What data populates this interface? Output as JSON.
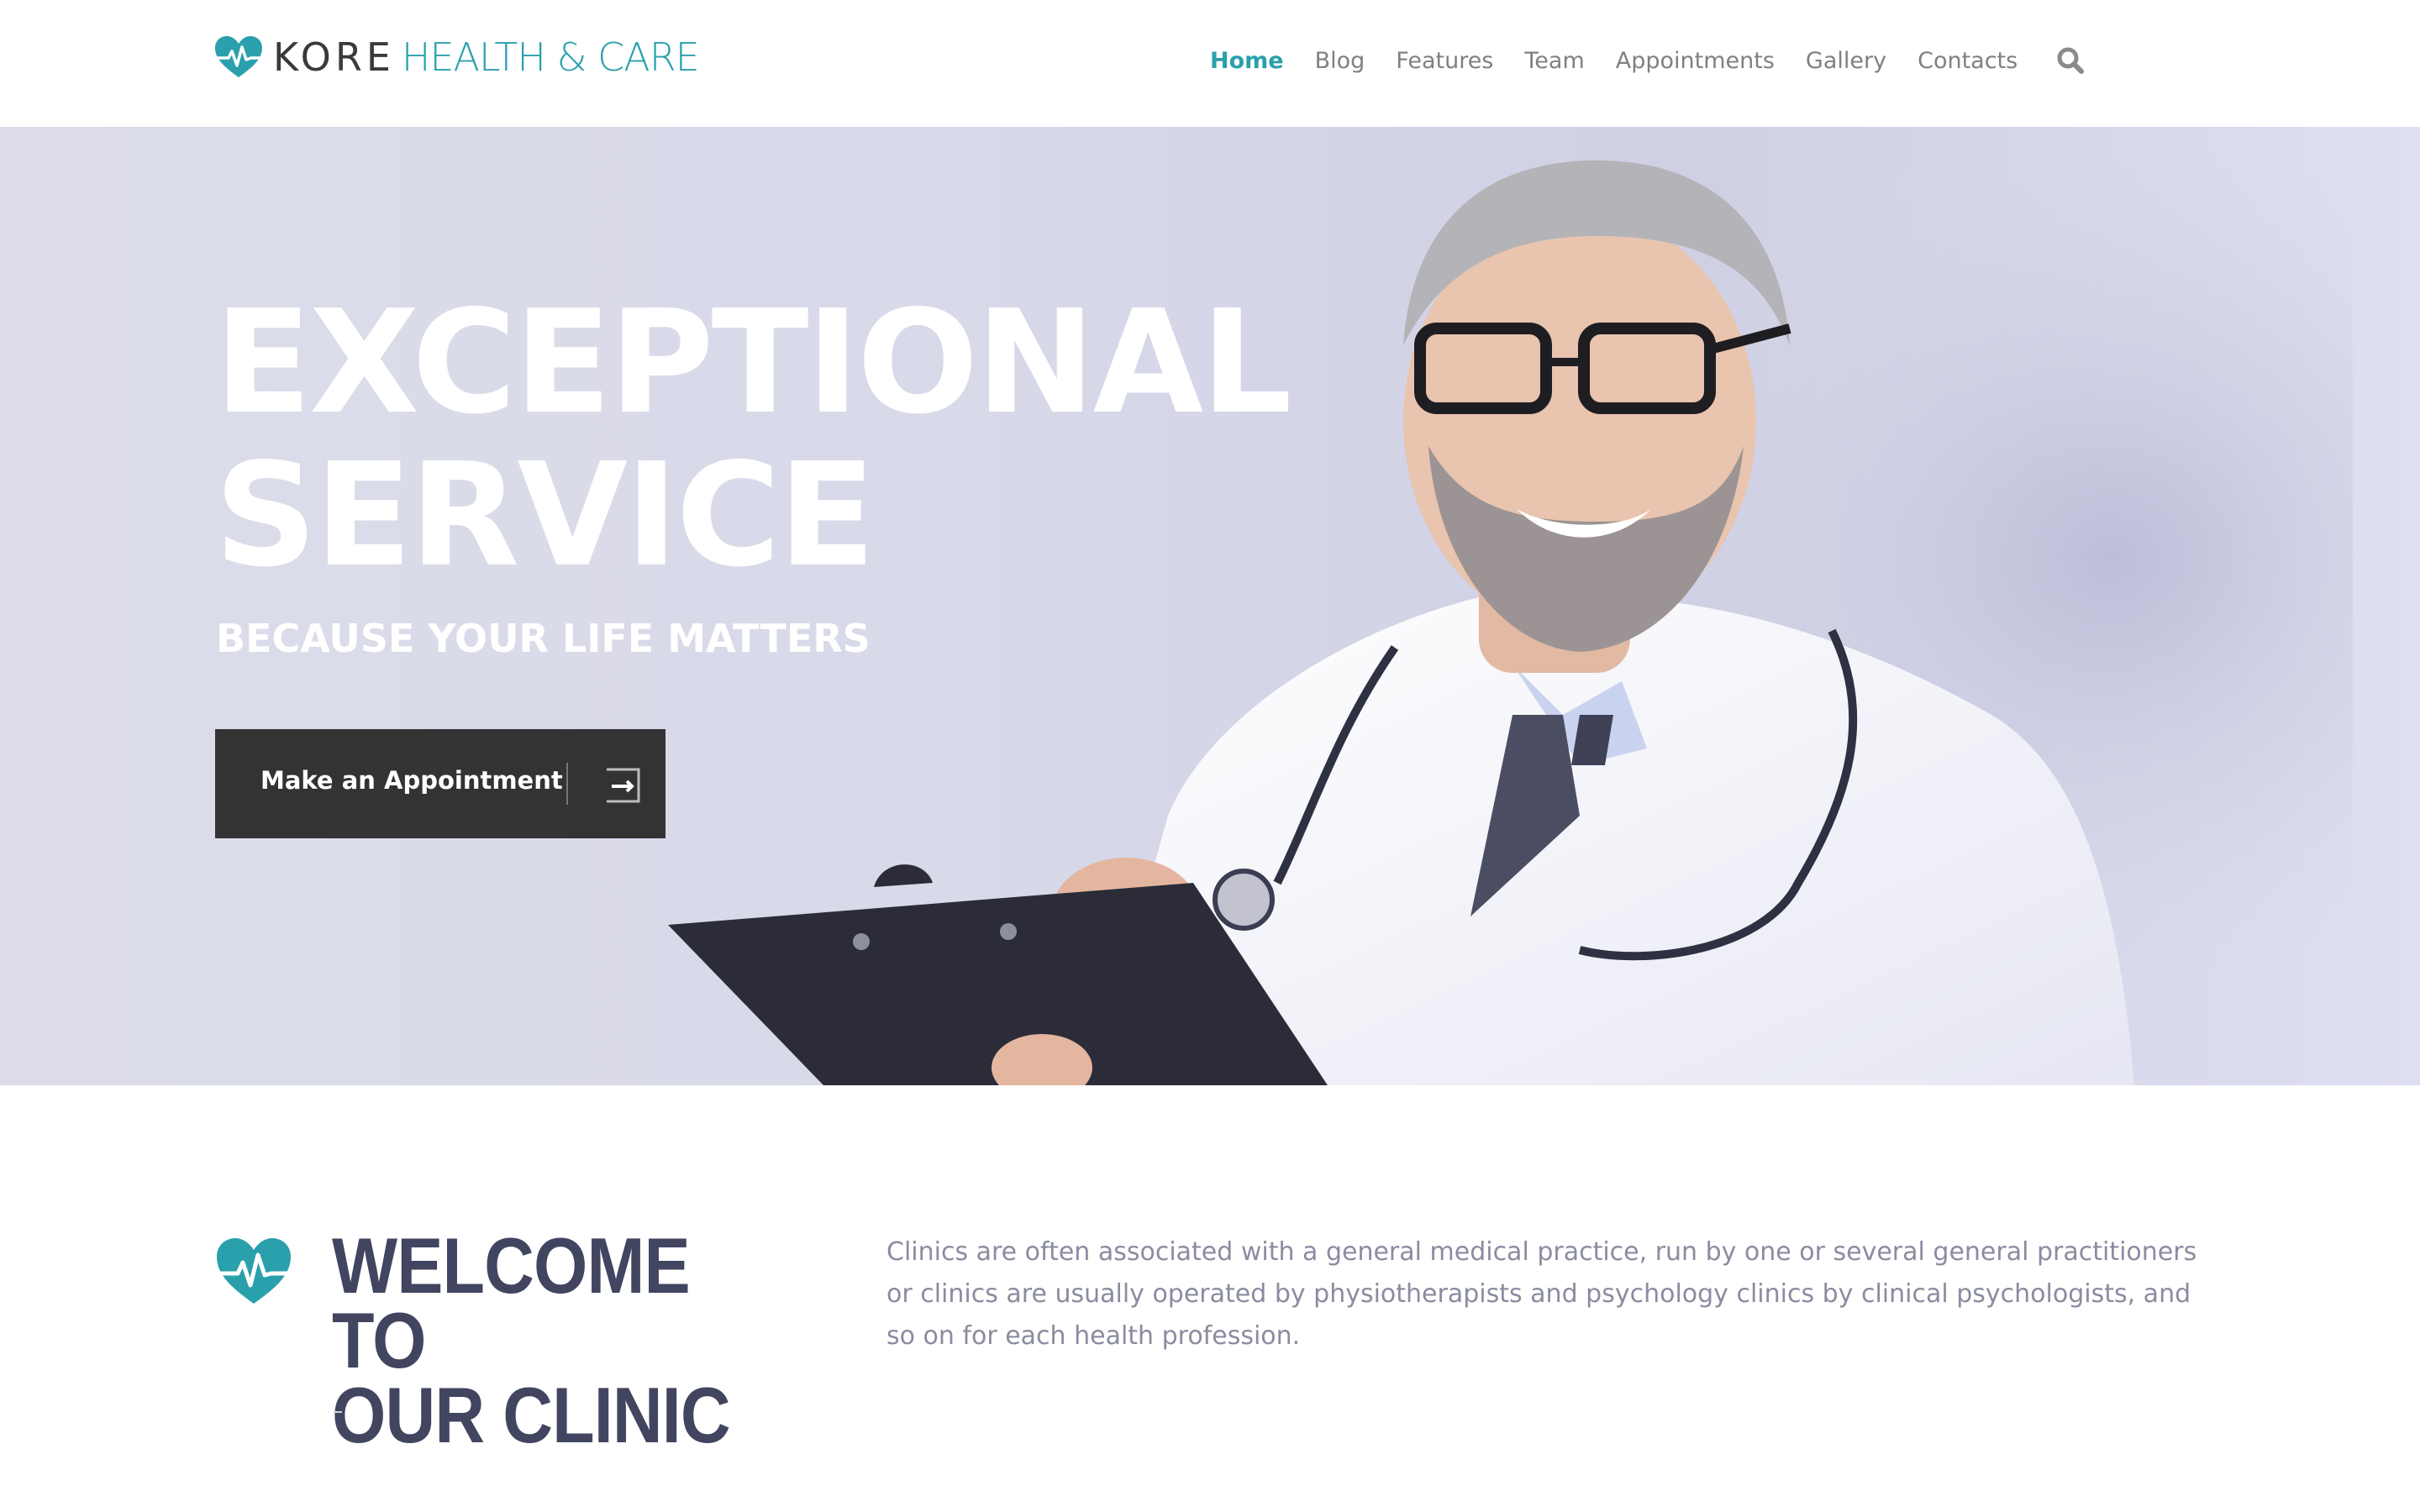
{
  "brand": {
    "name_primary": "KORE",
    "name_secondary": "HEALTH & CARE",
    "icon": "heart-pulse-icon",
    "accent_color": "#2aa0ac"
  },
  "nav": {
    "items": [
      {
        "label": "Home",
        "active": true
      },
      {
        "label": "Blog",
        "active": false
      },
      {
        "label": "Features",
        "active": false
      },
      {
        "label": "Team",
        "active": false
      },
      {
        "label": "Appointments",
        "active": false
      },
      {
        "label": "Gallery",
        "active": false
      },
      {
        "label": "Contacts",
        "active": false
      }
    ],
    "search_icon": "search-icon"
  },
  "hero": {
    "title_line1": "EXCEPTIONAL",
    "title_line2": "SERVICE",
    "subtitle": "BECAUSE YOUR LIFE MATTERS",
    "cta_label": "Make an Appointment",
    "cta_icon": "arrow-right-icon",
    "cta_color": "#333333"
  },
  "welcome": {
    "title_line1": "WELCOME TO",
    "title_line2": "OUR CLINIC",
    "icon": "heart-pulse-icon",
    "text": "Clinics are often associated with a general medical practice, run by one or several general practitioners or clinics are usually operated by physiotherapists and psychology clinics by clinical psychologists, and so on for each health profession.",
    "title_color": "#424560"
  }
}
